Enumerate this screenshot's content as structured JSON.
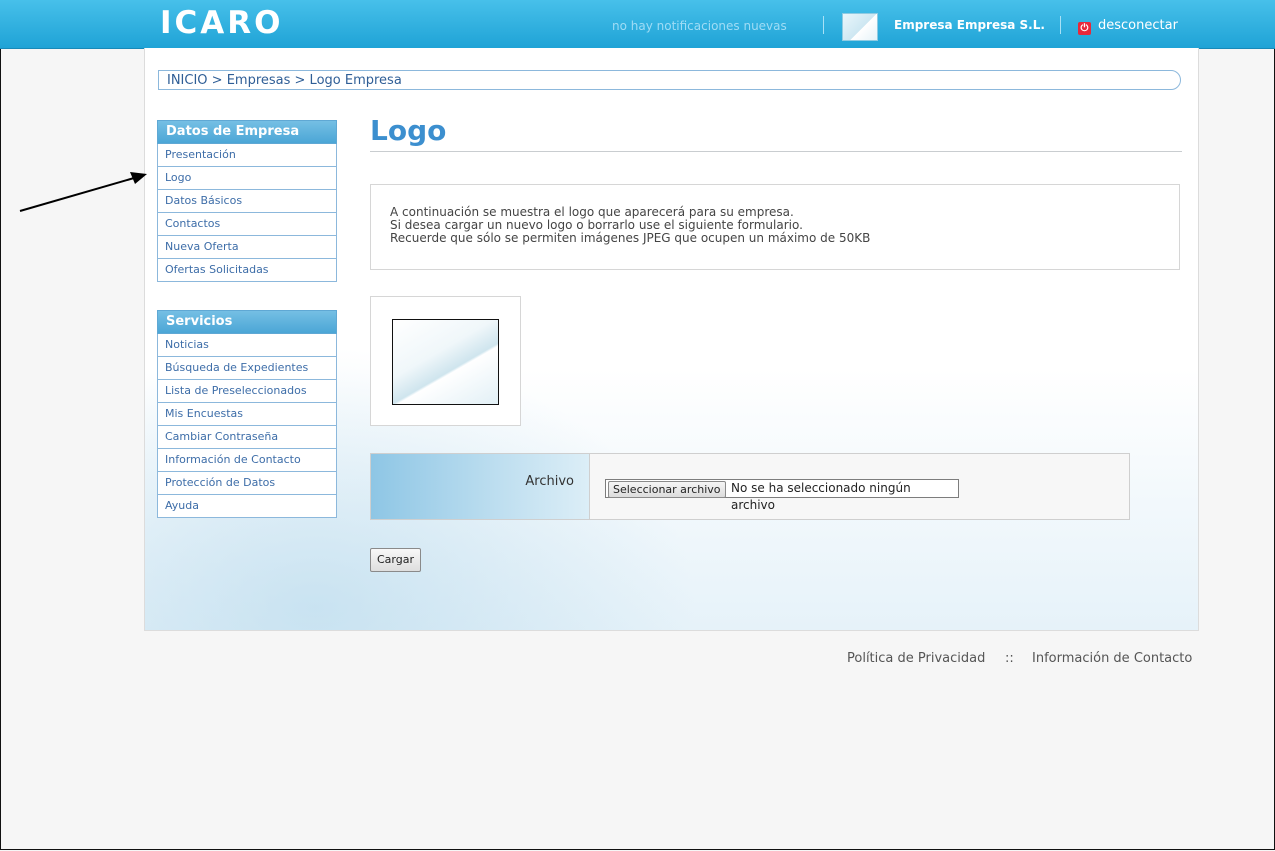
{
  "header": {
    "brand": "ICARO",
    "notifications": "no hay notificaciones nuevas",
    "company": "Empresa Empresa S.L.",
    "logout": "desconectar",
    "brand_color": "#22a7da"
  },
  "breadcrumb": "INICIO > Empresas > Logo Empresa",
  "sidebar": {
    "company_section": {
      "title": "Datos de Empresa",
      "items": [
        "Presentación",
        "Logo",
        "Datos Básicos",
        "Contactos",
        "Nueva Oferta",
        "Ofertas Solicitadas"
      ]
    },
    "services_section": {
      "title": "Servicios",
      "items": [
        "Noticias",
        "Búsqueda de Expedientes",
        "Lista de Preseleccionados",
        "Mis Encuestas",
        "Cambiar Contraseña",
        "Información de Contacto",
        "Protección de Datos",
        "Ayuda"
      ]
    }
  },
  "main": {
    "title": "Logo",
    "info_lines": [
      "A continuación se muestra el logo que aparecerá para su empresa.",
      "Si desea cargar un nuevo logo o borrarlo use el siguiente formulario.",
      "Recuerde que sólo se permiten imágenes JPEG que ocupen un máximo de 50KB"
    ],
    "file_label": "Archivo",
    "file_button": "Seleccionar archivo",
    "file_status": "No se ha seleccionado ningún archivo",
    "submit": "Cargar"
  },
  "footer": {
    "privacy": "Política de Privacidad",
    "separator": "::",
    "contact": "Información de Contacto"
  }
}
